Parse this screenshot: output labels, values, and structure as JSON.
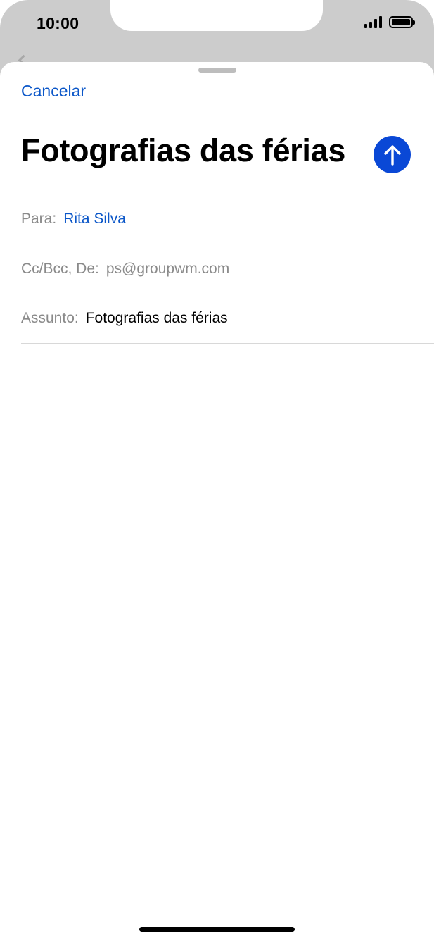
{
  "status_bar": {
    "time": "10:00",
    "signal_icon": "cellular-signal-icon",
    "battery_icon": "battery-icon",
    "battery_level": 1.0
  },
  "compose": {
    "cancel_label": "Cancelar",
    "title": "Fotografias das férias",
    "send_icon": "arrow-up-icon",
    "to_label": "Para:",
    "to_value": "Rita Silva",
    "cc_label": "Cc/Bcc, De:",
    "cc_value": "ps@groupwm.com",
    "subject_label": "Assunto:",
    "subject_value": "Fotografias das férias"
  },
  "colors": {
    "accent": "#0a56c8",
    "send_button": "#0a48d6",
    "background": "#cccccc"
  }
}
